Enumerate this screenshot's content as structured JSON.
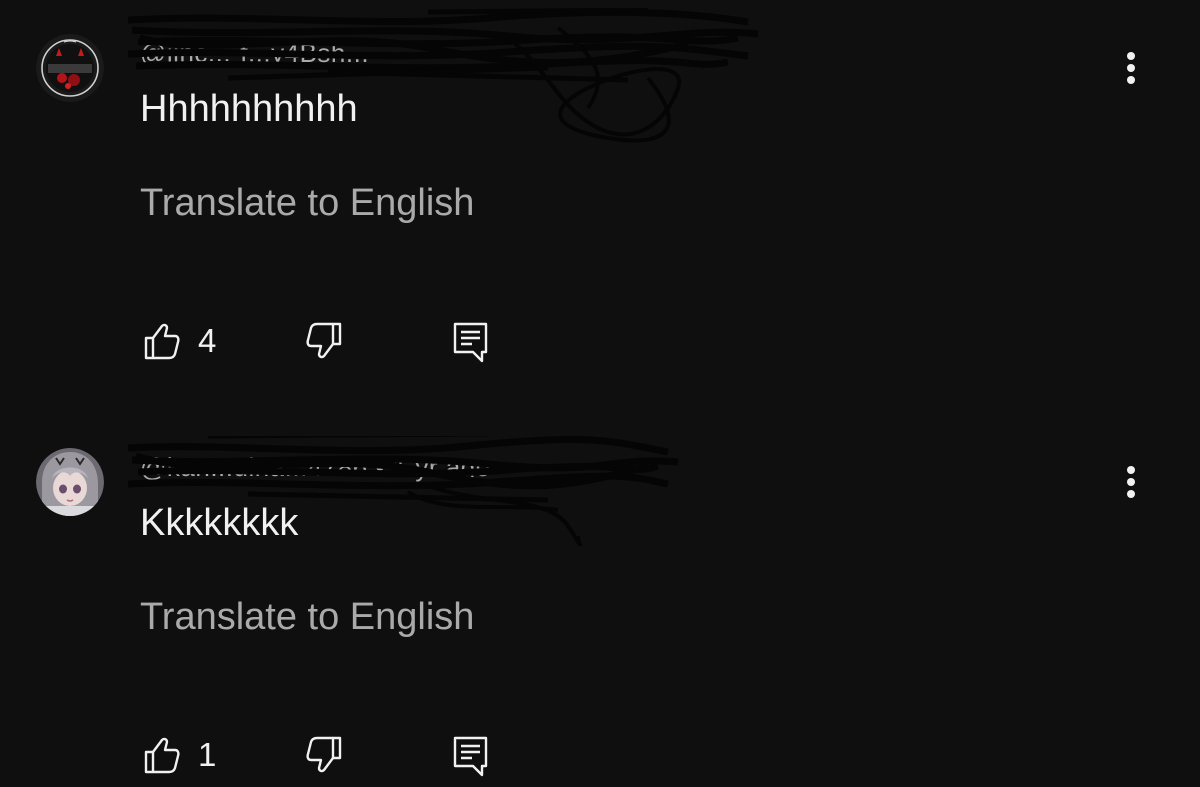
{
  "comments": [
    {
      "handle": "@jinc...-f...y4Bsh...",
      "text": "Hhhhhhhhhh",
      "translate_label": "Translate to English",
      "likes": "4",
      "avatar_icon": "devil-avatar-icon"
    },
    {
      "handle": "@kan...ulna...4786 • 1 yr ago",
      "text": "Kkkkkkkk",
      "translate_label": "Translate to English",
      "likes": "1",
      "avatar_icon": "anime-girl-avatar-icon"
    }
  ],
  "icons": {
    "like": "thumbs-up-icon",
    "dislike": "thumbs-down-icon",
    "reply": "reply-comment-icon",
    "more": "more-vertical-icon"
  },
  "colors": {
    "background": "#0f0f0f",
    "primary_text": "#f1f1f1",
    "secondary_text": "#aaaaaa"
  }
}
